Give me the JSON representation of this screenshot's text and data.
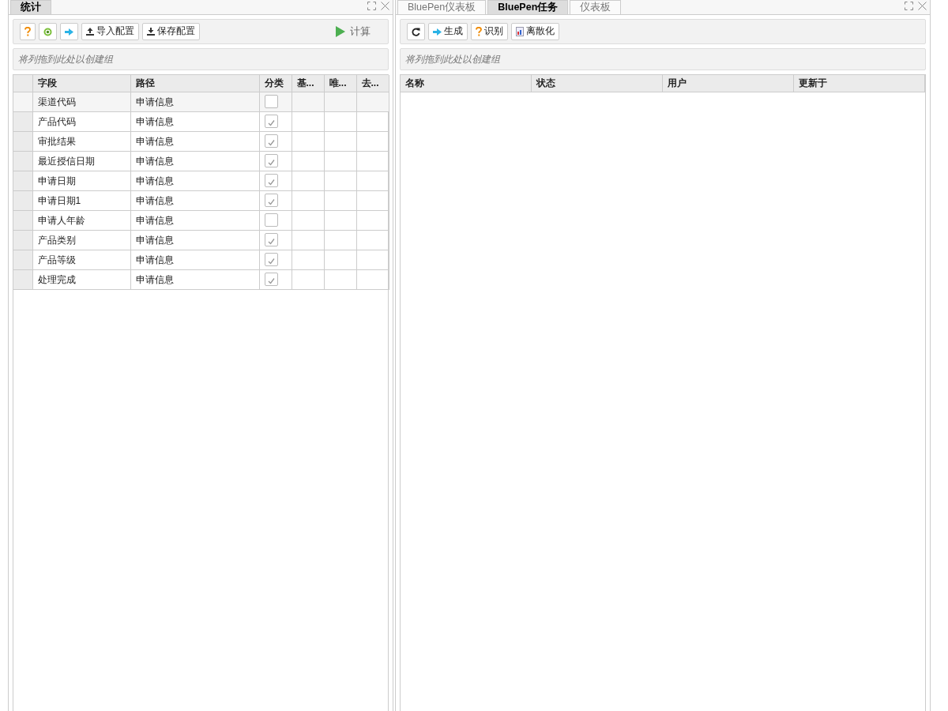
{
  "left_panel": {
    "tabs": [
      {
        "label": "统计",
        "selected": true
      }
    ],
    "toolbar": [
      {
        "kind": "help"
      },
      {
        "kind": "target"
      },
      {
        "kind": "arrow"
      },
      {
        "kind": "upload",
        "label": "导入配置"
      },
      {
        "kind": "download",
        "label": "保存配置"
      }
    ],
    "run_button": {
      "label": "计算"
    },
    "group_hint": "将列拖到此处以创建组",
    "table": {
      "columns": [
        "字段",
        "路径",
        "分类",
        "基...",
        "唯...",
        "去..."
      ],
      "rows": [
        {
          "field": "渠道代码",
          "path": "申请信息",
          "checked": false,
          "selected": true
        },
        {
          "field": "产品代码",
          "path": "申请信息",
          "checked": true,
          "selected": false
        },
        {
          "field": "审批结果",
          "path": "申请信息",
          "checked": true,
          "selected": false
        },
        {
          "field": "最近授信日期",
          "path": "申请信息",
          "checked": true,
          "selected": false
        },
        {
          "field": "申请日期",
          "path": "申请信息",
          "checked": true,
          "selected": false
        },
        {
          "field": "申请日期1",
          "path": "申请信息",
          "checked": true,
          "selected": false
        },
        {
          "field": "申请人年龄",
          "path": "申请信息",
          "checked": false,
          "selected": false
        },
        {
          "field": "产品类别",
          "path": "申请信息",
          "checked": true,
          "selected": false
        },
        {
          "field": "产品等级",
          "path": "申请信息",
          "checked": true,
          "selected": false
        },
        {
          "field": "处理完成",
          "path": "申请信息",
          "checked": true,
          "selected": false
        }
      ]
    }
  },
  "right_panel": {
    "tabs": [
      {
        "label": "BluePen仪表板",
        "selected": false
      },
      {
        "label": "BluePen任务",
        "selected": true
      },
      {
        "label": "仪表板",
        "selected": false
      }
    ],
    "toolbar": [
      {
        "kind": "refresh"
      },
      {
        "kind": "arrow",
        "label": "生成"
      },
      {
        "kind": "help",
        "label": "识别"
      },
      {
        "kind": "chart",
        "label": "离散化"
      }
    ],
    "group_hint": "将列拖到此处以创建组",
    "table": {
      "columns": [
        "名称",
        "状态",
        "用户",
        "更新于"
      ]
    }
  }
}
